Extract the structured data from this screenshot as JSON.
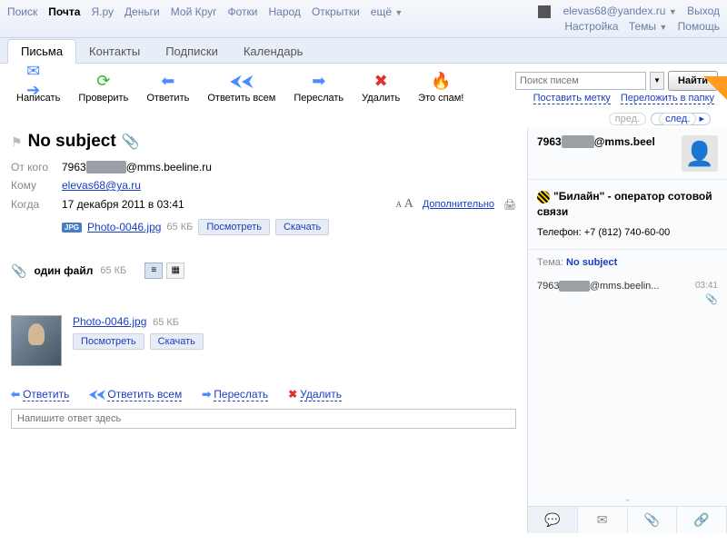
{
  "topnav": {
    "links": [
      "Поиск",
      "Почта",
      "Я.ру",
      "Деньги",
      "Мой Круг",
      "Фотки",
      "Народ",
      "Открытки",
      "ещё"
    ],
    "active_index": 1,
    "user": "elevas68@yandex.ru",
    "right1": [
      "Выход"
    ],
    "right2": [
      "Настройка",
      "Темы",
      "Помощь"
    ]
  },
  "tabs": {
    "items": [
      "Письма",
      "Контакты",
      "Подписки",
      "Календарь"
    ],
    "active_index": 0
  },
  "toolbar": {
    "compose": "Написать",
    "check": "Проверить",
    "reply": "Ответить",
    "reply_all": "Ответить всем",
    "forward": "Переслать",
    "delete": "Удалить",
    "spam": "Это спам!",
    "search_placeholder": "Поиск писем",
    "find": "Найти",
    "set_label": "Поставить метку",
    "move_to": "Переложить в папку"
  },
  "nav": {
    "prev": "пред.",
    "next": "след."
  },
  "message": {
    "subject": "No subject",
    "from_label": "От кого",
    "from": "7963▮▮▮▮▮@mms.beeline.ru",
    "to_label": "Кому",
    "to": "elevas68@ya.ru",
    "when_label": "Когда",
    "when": "17 декабря 2011 в 03:41",
    "extra": "Дополнительно",
    "attachment": {
      "name": "Photo-0046.jpg",
      "size": "65 КБ",
      "view": "Посмотреть",
      "download": "Скачать"
    },
    "files_header": "один файл",
    "files_size": "65 КБ"
  },
  "actions": {
    "reply": "Ответить",
    "reply_all": "Ответить всем",
    "forward": "Переслать",
    "delete": "Удалить"
  },
  "reply_placeholder": "Напишите ответ здесь",
  "side": {
    "sender": "7963▮▮▮▮▮@mms.beel",
    "card_title": "\"Билайн\" - оператор сотовой связи",
    "card_phone_label": "Телефон:",
    "card_phone": "+7 (812) 740-60-00",
    "theme_label": "Тема:",
    "theme_value": "No subject",
    "thread_sender": "7963▮▮▮▮▮@mms.beelin...",
    "thread_time": "03:41"
  }
}
